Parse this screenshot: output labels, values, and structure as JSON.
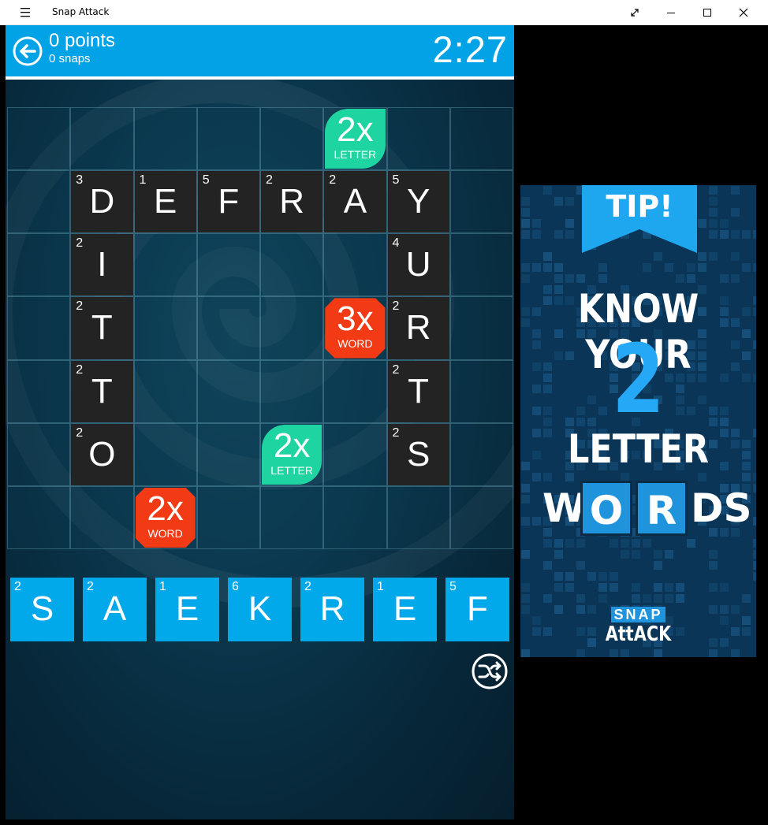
{
  "window": {
    "title": "Snap Attack"
  },
  "header": {
    "points": "0 points",
    "snaps": "0 snaps",
    "timer": "2:27"
  },
  "board": {
    "rows": 7,
    "cols": 8,
    "tiles": [
      {
        "row": 1,
        "col": 1,
        "letter": "D",
        "score": "3"
      },
      {
        "row": 1,
        "col": 2,
        "letter": "E",
        "score": "1"
      },
      {
        "row": 1,
        "col": 3,
        "letter": "F",
        "score": "5"
      },
      {
        "row": 1,
        "col": 4,
        "letter": "R",
        "score": "2"
      },
      {
        "row": 1,
        "col": 5,
        "letter": "A",
        "score": "2"
      },
      {
        "row": 1,
        "col": 6,
        "letter": "Y",
        "score": "5"
      },
      {
        "row": 2,
        "col": 1,
        "letter": "I",
        "score": "2"
      },
      {
        "row": 3,
        "col": 1,
        "letter": "T",
        "score": "2"
      },
      {
        "row": 4,
        "col": 1,
        "letter": "T",
        "score": "2"
      },
      {
        "row": 5,
        "col": 1,
        "letter": "O",
        "score": "2"
      },
      {
        "row": 2,
        "col": 6,
        "letter": "U",
        "score": "4"
      },
      {
        "row": 3,
        "col": 6,
        "letter": "R",
        "score": "2"
      },
      {
        "row": 4,
        "col": 6,
        "letter": "T",
        "score": "2"
      },
      {
        "row": 5,
        "col": 6,
        "letter": "S",
        "score": "2"
      }
    ],
    "bonuses": [
      {
        "row": 0,
        "col": 5,
        "big": "2x",
        "small": "LETTER",
        "kind": "letter"
      },
      {
        "row": 3,
        "col": 5,
        "big": "3x",
        "small": "WORD",
        "kind": "word"
      },
      {
        "row": 5,
        "col": 4,
        "big": "2x",
        "small": "LETTER",
        "kind": "letter"
      },
      {
        "row": 6,
        "col": 2,
        "big": "2x",
        "small": "WORD",
        "kind": "word"
      }
    ]
  },
  "rack": [
    {
      "letter": "S",
      "score": "2"
    },
    {
      "letter": "A",
      "score": "2"
    },
    {
      "letter": "E",
      "score": "1"
    },
    {
      "letter": "K",
      "score": "6"
    },
    {
      "letter": "R",
      "score": "2"
    },
    {
      "letter": "E",
      "score": "1"
    },
    {
      "letter": "F",
      "score": "5"
    }
  ],
  "icons": {
    "menu": "hamburger-menu-icon",
    "back": "back-arrow-icon",
    "shuffle": "shuffle-icon",
    "minimize": "minimize-icon",
    "maximize": "maximize-icon",
    "close": "close-icon",
    "expand": "expand-icon"
  },
  "ad": {
    "tip": "TIP!",
    "line1": "KNOW YOUR",
    "number": "2",
    "line3": "LETTER",
    "words_parts": [
      "W",
      "O",
      "R",
      "DS"
    ],
    "logo_top": "SNAP",
    "logo_bottom": "AttACK"
  },
  "colors": {
    "header": "#01a2e6",
    "rack_tile": "#01a8ea",
    "board_tile": "#232323",
    "bonus_letter": "#1ed4a0",
    "bonus_word": "#f23a14",
    "ad_accent": "#25a8f5"
  }
}
